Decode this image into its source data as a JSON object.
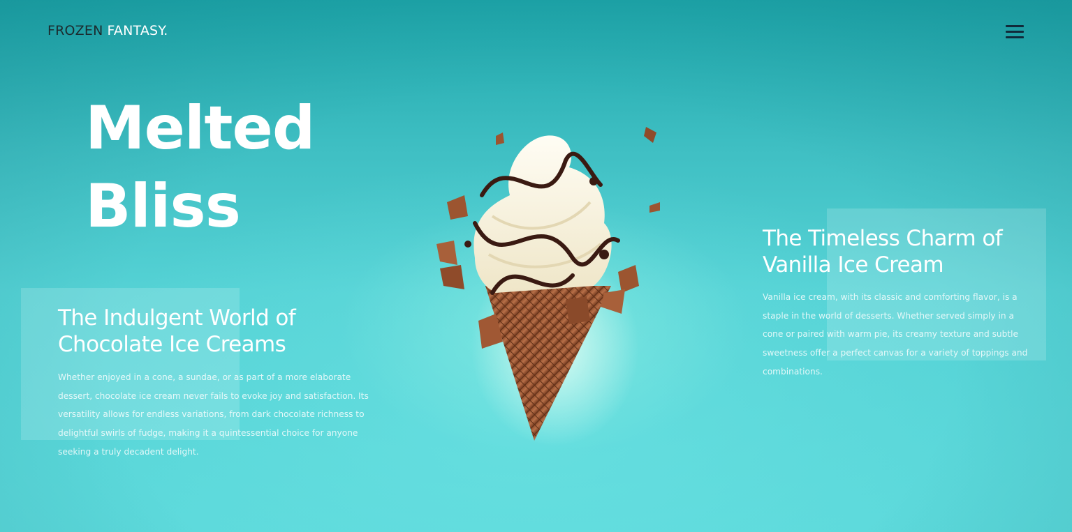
{
  "header": {
    "logo_dark": "FROZEN",
    "logo_light": "FANTASY.",
    "menu_icon": "hamburger-menu-icon"
  },
  "hero": {
    "line1": "Melted",
    "line2": "Bliss"
  },
  "chocolate_section": {
    "title_line1": "The Indulgent World of",
    "title_line2": "Chocolate Ice Creams",
    "body_lines": [
      "Whether enjoyed in a cone, a sundae, or as part of a more elaborate",
      "dessert, chocolate ice cream never fails to evoke joy and satisfaction. Its",
      "versatility allows for endless variations, from dark chocolate richness to",
      "delightful swirls of fudge, making it a quintessential choice for anyone",
      "seeking a truly decadent delight."
    ]
  },
  "vanilla_section": {
    "title_line1": "The Timeless Charm of",
    "title_line2": "Vanilla Ice Cream",
    "body_lines": [
      "Vanilla ice cream, with its classic and comforting flavor, is a",
      "staple in the world of desserts. Whether served simply in a",
      "cone or paired with warm pie, its creamy texture and subtle",
      "sweetness offer a perfect canvas for a variety of toppings and",
      "combinations."
    ]
  },
  "colors": {
    "background_top": "#1ea6aa",
    "background_bottom": "#5cd9db",
    "logo_dark": "#1c2b2e",
    "menu_icon": "#112a3a",
    "text": "#ffffff"
  }
}
